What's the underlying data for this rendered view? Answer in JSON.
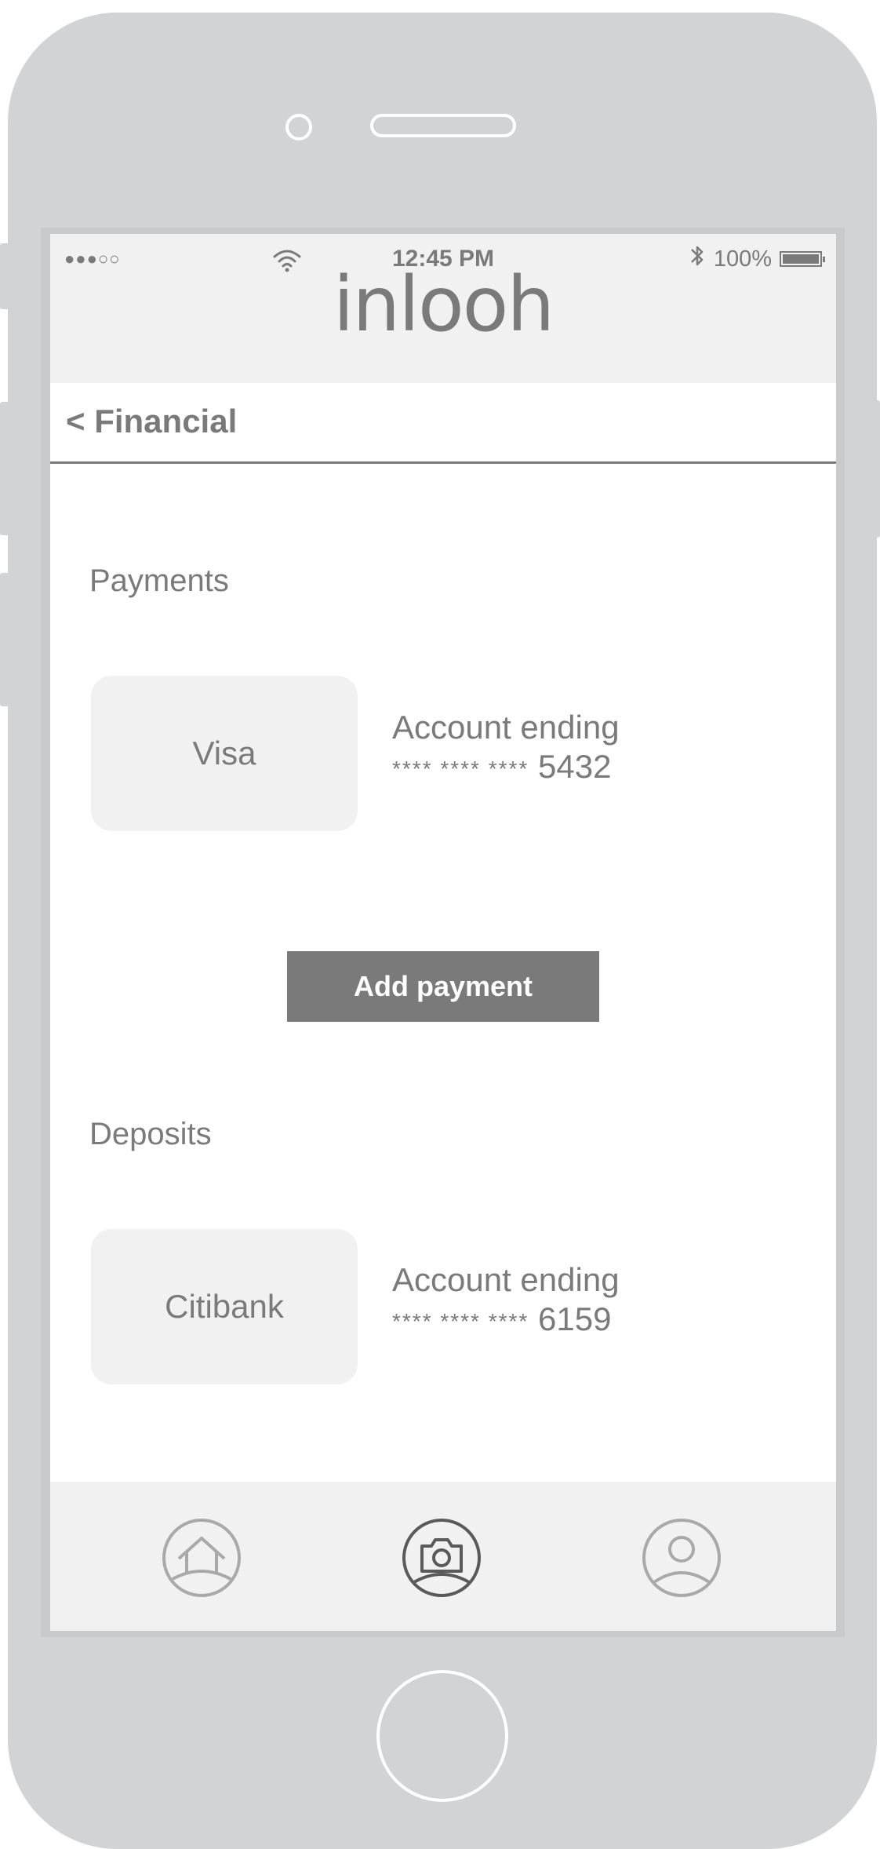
{
  "status_bar": {
    "signal": "●●●○○",
    "time": "12:45 PM",
    "battery": "100%"
  },
  "app": {
    "logo": "inlooh"
  },
  "nav": {
    "back_label": "< Financial"
  },
  "payments": {
    "section_title": "Payments",
    "card_label": "Visa",
    "account_label": "Account ending",
    "account_mask": "**** **** ****",
    "account_last4": "5432",
    "add_button": "Add payment"
  },
  "deposits": {
    "section_title": "Deposits",
    "card_label": "Citibank",
    "account_label": "Account ending",
    "account_mask": "**** **** ****",
    "account_last4": "6159"
  },
  "tab_bar": {
    "tabs": [
      {
        "icon": "home-icon",
        "active": false
      },
      {
        "icon": "camera-icon",
        "active": true
      },
      {
        "icon": "profile-icon",
        "active": false
      }
    ]
  },
  "colors": {
    "device": "#d2d3d5",
    "text": "#7a7a7a",
    "panel": "#f1f1f1",
    "button": "#7a7a7a",
    "active_icon": "#5a5a5a",
    "inactive_icon": "#a9a9a9"
  }
}
